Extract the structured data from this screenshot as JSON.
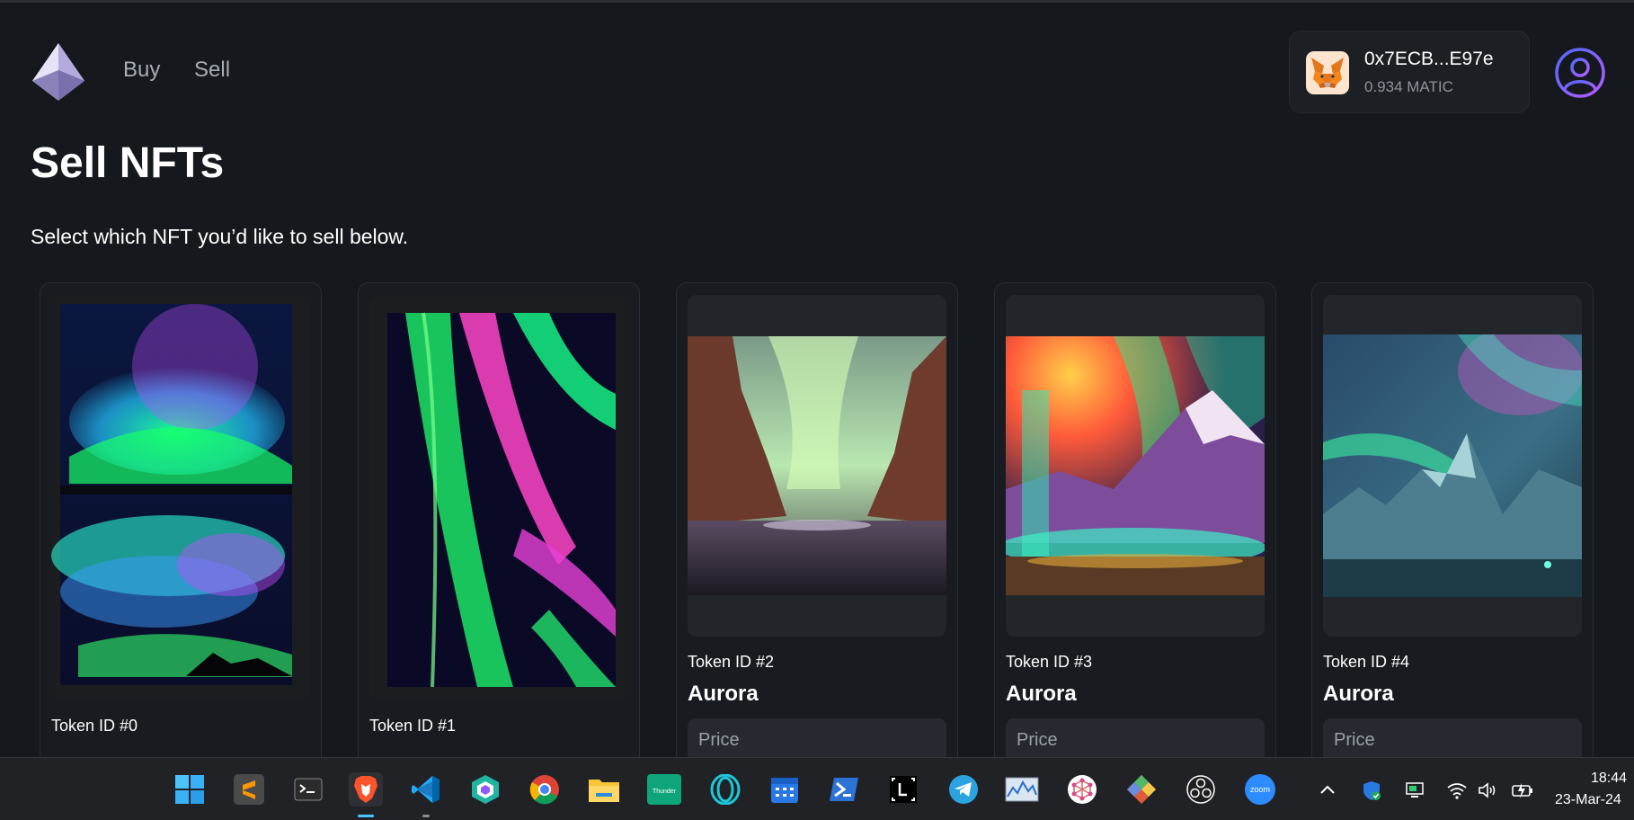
{
  "header": {
    "nav": [
      {
        "label": "Buy"
      },
      {
        "label": "Sell"
      }
    ],
    "wallet": {
      "address": "0x7ECB...E97e",
      "balance": "0.934 MATIC"
    }
  },
  "main": {
    "title": "Sell NFTs",
    "subtitle": "Select which NFT you’d like to sell below.",
    "cards": [
      {
        "token_id": "Token ID #0"
      },
      {
        "token_id": "Token ID #1"
      },
      {
        "token_id": "Token ID #2",
        "name": "Aurora",
        "price_placeholder": "Price"
      },
      {
        "token_id": "Token ID #3",
        "name": "Aurora",
        "price_placeholder": "Price"
      },
      {
        "token_id": "Token ID #4",
        "name": "Aurora",
        "price_placeholder": "Price"
      }
    ]
  },
  "taskbar": {
    "apps": [
      "windows-start-icon",
      "sublime-text-icon",
      "terminal-icon",
      "brave-browser-icon",
      "vscode-icon",
      "polygon-app-icon",
      "chrome-icon",
      "file-explorer-icon",
      "thunder-client-icon",
      "opera-icon",
      "calendar-icon",
      "powershell-icon",
      "lightshot-icon",
      "telegram-icon",
      "resource-monitor-icon",
      "graph-app-icon",
      "git-icon",
      "obs-studio-icon",
      "zoom-icon"
    ],
    "zoom_label": "zoom",
    "clock": {
      "time": "18:44",
      "date": "23-Mar-24"
    }
  },
  "colors": {
    "background": "#15181c",
    "card": "#181b1f",
    "accent": "#5b6bff"
  }
}
